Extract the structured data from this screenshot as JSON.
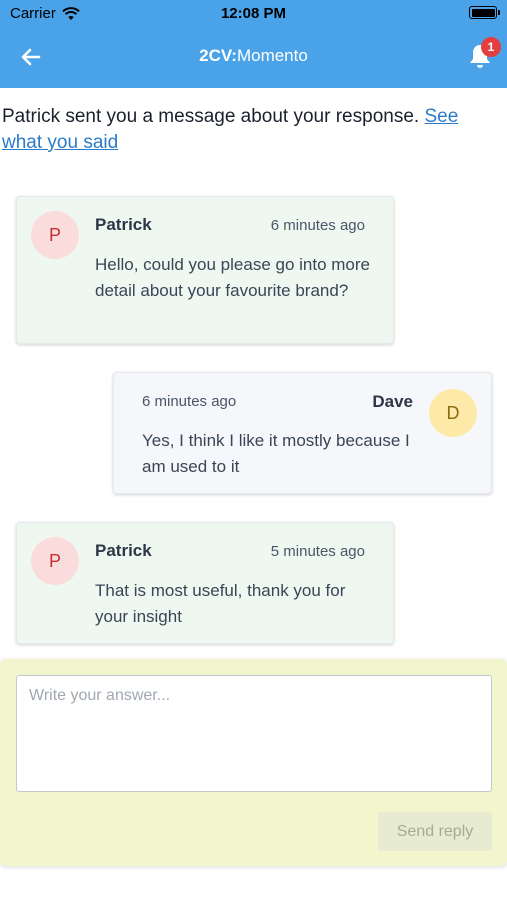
{
  "status_bar": {
    "carrier": "Carrier",
    "time": "12:08 PM"
  },
  "nav": {
    "title_brand": "2CV:",
    "title_product": "Momento",
    "notification_count": "1",
    "back_icon": "arrow-left-icon",
    "bell_icon": "bell-icon"
  },
  "intro": {
    "text": "Patrick sent you a message about your response. ",
    "link": "See what you said"
  },
  "messages": [
    {
      "author": "Patrick",
      "initial": "P",
      "time": "6 minutes ago",
      "body": "Hello, could you please go into more detail about your favourite brand?"
    },
    {
      "author": "Dave",
      "initial": "D",
      "time": "6 minutes ago",
      "body": "Yes, I think I like it mostly because I am used to it"
    },
    {
      "author": "Patrick",
      "initial": "P",
      "time": "5 minutes ago",
      "body": "That is most useful, thank you for your insight"
    }
  ],
  "reply": {
    "placeholder": "Write your answer...",
    "send_label": "Send reply"
  },
  "colors": {
    "header": "#4aa3e8",
    "link": "#2b7bc9",
    "badge": "#e53e3e",
    "incoming_bg": "#eef8f1",
    "outgoing_bg": "#f5f7fa",
    "reply_bg": "#f3f6cc"
  }
}
